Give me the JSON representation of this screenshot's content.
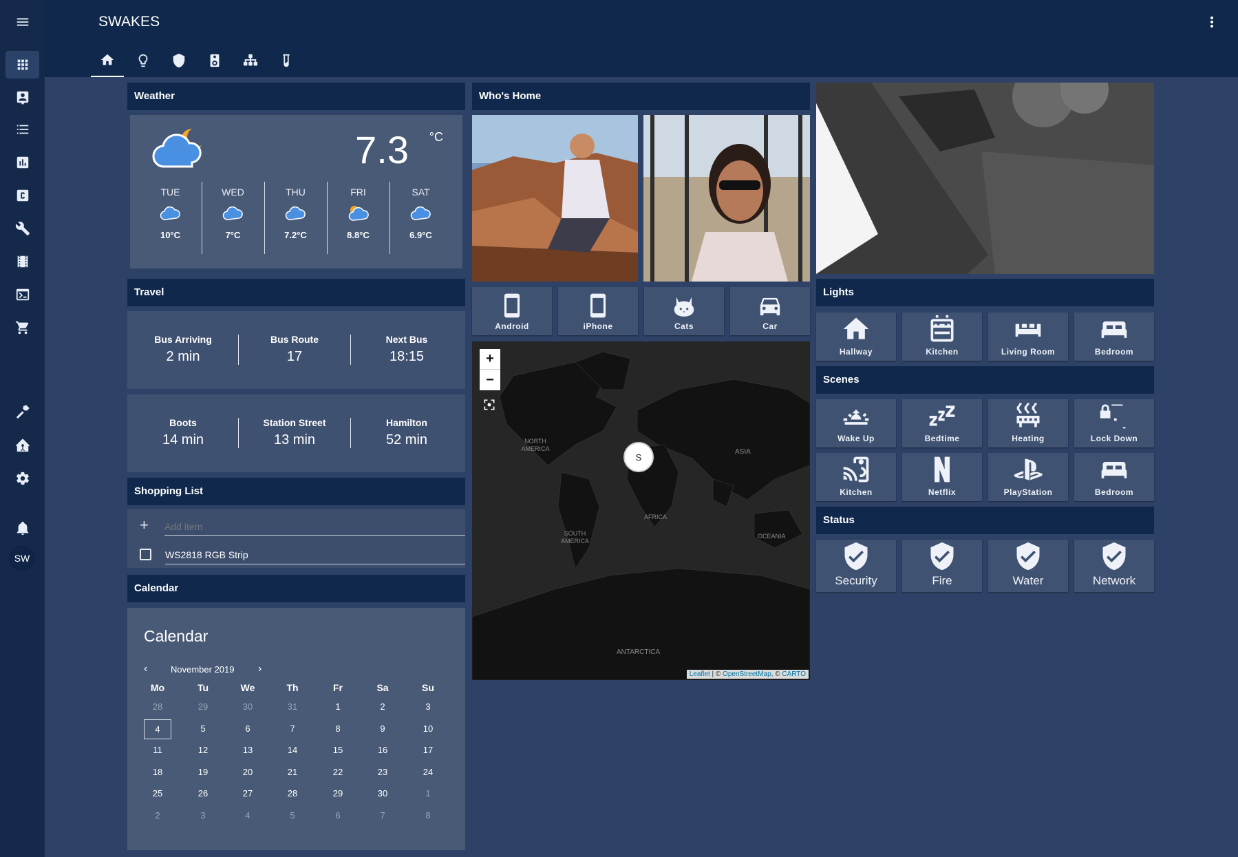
{
  "app": {
    "title": "SWAKES",
    "user_initials": "SW"
  },
  "sidebar": {
    "items": [
      {
        "name": "menu-icon"
      },
      {
        "name": "overview-icon"
      },
      {
        "name": "person-card-icon"
      },
      {
        "name": "list-icon"
      },
      {
        "name": "chart-icon"
      },
      {
        "name": "c-icon"
      },
      {
        "name": "wrench-icon"
      },
      {
        "name": "film-icon"
      },
      {
        "name": "terminal-icon"
      },
      {
        "name": "cart-icon"
      },
      {
        "name": "hammer-icon"
      },
      {
        "name": "home-assistant-icon"
      },
      {
        "name": "gear-icon"
      },
      {
        "name": "bell-icon"
      }
    ]
  },
  "tabs": [
    {
      "name": "home-icon",
      "active": true
    },
    {
      "name": "lightbulb-icon"
    },
    {
      "name": "shield-icon"
    },
    {
      "name": "speaker-icon"
    },
    {
      "name": "network-icon"
    },
    {
      "name": "test-tube-icon"
    }
  ],
  "weather": {
    "header": "Weather",
    "current_temp": "7.3",
    "unit": "°C",
    "forecast": [
      {
        "day": "TUE",
        "temp": "10°C"
      },
      {
        "day": "WED",
        "temp": "7°C"
      },
      {
        "day": "THU",
        "temp": "7.2°C"
      },
      {
        "day": "FRI",
        "temp": "8.8°C"
      },
      {
        "day": "SAT",
        "temp": "6.9°C"
      }
    ]
  },
  "travel": {
    "header": "Travel",
    "row1": [
      {
        "label": "Bus Arriving",
        "value": "2 min"
      },
      {
        "label": "Bus Route",
        "value": "17"
      },
      {
        "label": "Next Bus",
        "value": "18:15"
      }
    ],
    "row2": [
      {
        "label": "Boots",
        "value": "14 min"
      },
      {
        "label": "Station Street",
        "value": "13 min"
      },
      {
        "label": "Hamilton",
        "value": "52 min"
      }
    ]
  },
  "shopping": {
    "header": "Shopping List",
    "add_placeholder": "Add item",
    "items": [
      "WS2818 RGB Strip"
    ]
  },
  "calendar": {
    "header": "Calendar",
    "title": "Calendar",
    "month": "November 2019",
    "weekdays": [
      "Mo",
      "Tu",
      "We",
      "Th",
      "Fr",
      "Sa",
      "Su"
    ],
    "weeks": [
      [
        "28",
        "29",
        "30",
        "31",
        "1",
        "2",
        "3"
      ],
      [
        "4",
        "5",
        "6",
        "7",
        "8",
        "9",
        "10"
      ],
      [
        "11",
        "12",
        "13",
        "14",
        "15",
        "16",
        "17"
      ],
      [
        "18",
        "19",
        "20",
        "21",
        "22",
        "23",
        "24"
      ],
      [
        "25",
        "26",
        "27",
        "28",
        "29",
        "30",
        "1"
      ],
      [
        "2",
        "3",
        "4",
        "5",
        "6",
        "7",
        "8"
      ]
    ],
    "selected": "4"
  },
  "whos_home": {
    "header": "Who's Home",
    "devices": [
      {
        "label": "Android",
        "icon": "cellphone-icon"
      },
      {
        "label": "iPhone",
        "icon": "cellphone-icon"
      },
      {
        "label": "Cats",
        "icon": "cat-icon"
      },
      {
        "label": "Car",
        "icon": "car-icon"
      }
    ]
  },
  "map": {
    "zoom_in": "+",
    "zoom_out": "−",
    "marker": "S",
    "labels": [
      "NORTH AMERICA",
      "ASIA",
      "AFRICA",
      "SOUTH AMERICA",
      "OCEANIA",
      "ANTARCTICA"
    ],
    "attribution_sep1": " | © ",
    "attribution_sep2": ", © ",
    "attribution_leaflet": "Leaflet",
    "attribution_osm": "OpenStreetMap",
    "attribution_carto": "CARTO"
  },
  "lights": {
    "header": "Lights",
    "items": [
      {
        "label": "Hallway",
        "icon": "home-icon"
      },
      {
        "label": "Kitchen",
        "icon": "stove-icon"
      },
      {
        "label": "Living Room",
        "icon": "sofa-icon"
      },
      {
        "label": "Bedroom",
        "icon": "bed-icon"
      }
    ]
  },
  "scenes": {
    "header": "Scenes",
    "items": [
      {
        "label": "Wake Up",
        "icon": "sunrise-icon"
      },
      {
        "label": "Bedtime",
        "icon": "sleep-icon"
      },
      {
        "label": "Heating",
        "icon": "radiator-icon"
      },
      {
        "label": "Lock Down",
        "icon": "lock-door-icon"
      },
      {
        "label": "Kitchen",
        "icon": "cast-speaker-icon"
      },
      {
        "label": "Netflix",
        "icon": "netflix-icon"
      },
      {
        "label": "PlayStation",
        "icon": "playstation-icon"
      },
      {
        "label": "Bedroom",
        "icon": "bed-icon"
      }
    ]
  },
  "status": {
    "header": "Status",
    "items": [
      {
        "label": "Security",
        "icon": "shield-check-icon"
      },
      {
        "label": "Fire",
        "icon": "shield-check-icon"
      },
      {
        "label": "Water",
        "icon": "shield-check-icon"
      },
      {
        "label": "Network",
        "icon": "shield-check-icon"
      }
    ]
  },
  "colors": {
    "header": "#10284b",
    "background": "#2e4267",
    "panel": "#485a76",
    "tile": "#3f5272",
    "sun": "#f5a623",
    "cloud": "#4a90e2"
  }
}
